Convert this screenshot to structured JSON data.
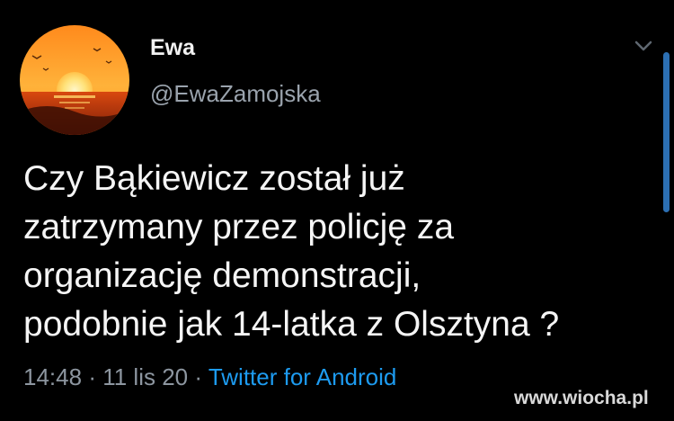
{
  "tweet": {
    "author": {
      "display_name": "Ewa",
      "handle": "@EwaZamojska",
      "avatar": "sunset-over-sea-icon"
    },
    "text_lines": [
      "Czy Bąkiewicz został już",
      "zatrzymany przez policję za",
      "organizację demonstracji,",
      "podobnie jak 14-latka z Olsztyna ?"
    ],
    "time": "14:48",
    "separator": "·",
    "date": "11 lis 20",
    "source": "Twitter for Android",
    "menu_icon": "chevron-down-icon"
  },
  "watermark": "www.wiocha.pl",
  "colors": {
    "background": "#000000",
    "text": "#f5f5f5",
    "secondary_text": "#8d96a0",
    "link": "#1d9bf0",
    "scrollbar": "#2c6fb3"
  }
}
